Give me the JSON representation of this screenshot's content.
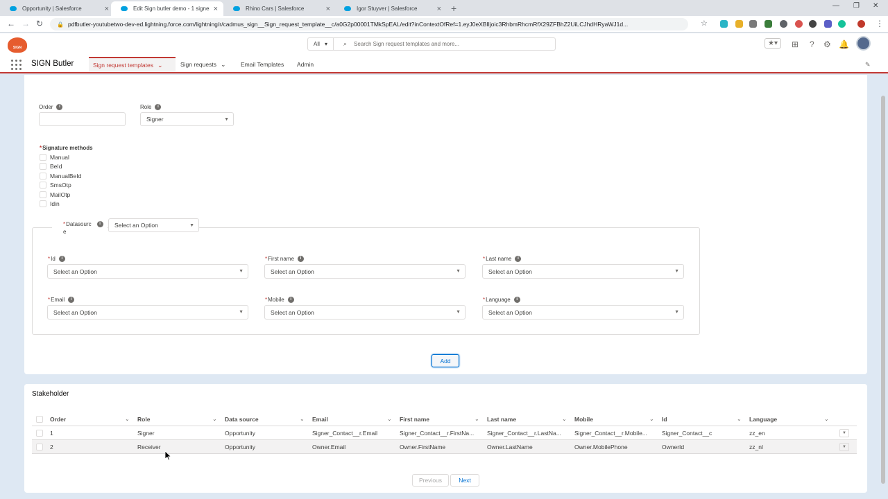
{
  "browser": {
    "tabs": [
      {
        "label": "Opportunity | Salesforce",
        "active": false
      },
      {
        "label": "Edit Sign butler demo - 1 signer",
        "active": true
      },
      {
        "label": "Rhino Cars | Salesforce",
        "active": false
      },
      {
        "label": "Igor Stuyver | Salesforce",
        "active": false
      }
    ],
    "url": "pdfbutler-youtubetwo-dev-ed.lightning.force.com/lightning/r/cadmus_sign__Sign_request_template__c/a0G2p00001TMkSpEAL/edit?inContextOfRef=1.eyJ0eXBlIjoic3RhbmRhcmRfX29ZFBhZ2UiLCJhdHRyaWJ1d..."
  },
  "header": {
    "search_scope": "All",
    "search_placeholder": "Search Sign request templates and more...",
    "logo_text": "SIGN BUTLER"
  },
  "nav": {
    "app_name": "SIGN Butler",
    "items": [
      {
        "label": "Sign request templates",
        "active": true,
        "has_menu": true
      },
      {
        "label": "Sign requests",
        "active": false,
        "has_menu": true
      },
      {
        "label": "Email Templates",
        "active": false,
        "has_menu": false
      },
      {
        "label": "Admin",
        "active": false,
        "has_menu": false
      }
    ]
  },
  "form": {
    "order_label": "Order",
    "order_value": "",
    "role_label": "Role",
    "role_value": "Signer",
    "signature_methods_label": "Signature methods",
    "signature_methods": [
      "Manual",
      "BeId",
      "ManualBeId",
      "SmsOtp",
      "MailOtp",
      "Idin"
    ],
    "datasource_label_1": "Datasourc",
    "datasource_label_2": "e",
    "datasource_value": "Select an Option",
    "fields": [
      {
        "label": "Id",
        "value": "Select an Option"
      },
      {
        "label": "First name",
        "value": "Select an Option"
      },
      {
        "label": "Last name",
        "value": "Select an Option"
      },
      {
        "label": "Email",
        "value": "Select an Option"
      },
      {
        "label": "Mobile",
        "value": "Select an Option"
      },
      {
        "label": "Language",
        "value": "Select an Option"
      }
    ],
    "add_label": "Add"
  },
  "stakeholder": {
    "title": "Stakeholder",
    "columns": [
      "Order",
      "Role",
      "Data source",
      "Email",
      "First name",
      "Last name",
      "Mobile",
      "Id",
      "Language"
    ],
    "rows": [
      [
        "1",
        "Signer",
        "Opportunity",
        "Signer_Contact__r.Email",
        "Signer_Contact__r.FirstNa...",
        "Signer_Contact__r.LastNa...",
        "Signer_Contact__r.Mobile...",
        "Signer_Contact__c",
        "zz_en"
      ],
      [
        "2",
        "Receiver",
        "Opportunity",
        "Owner.Email",
        "Owner.FirstName",
        "Owner.LastName",
        "Owner.MobilePhone",
        "OwnerId",
        "zz_nl"
      ]
    ],
    "previous_label": "Previous",
    "next_label": "Next"
  },
  "colors": {
    "brand_red": "#c23934",
    "link_blue": "#0070d2",
    "background": "#dee8f3"
  }
}
